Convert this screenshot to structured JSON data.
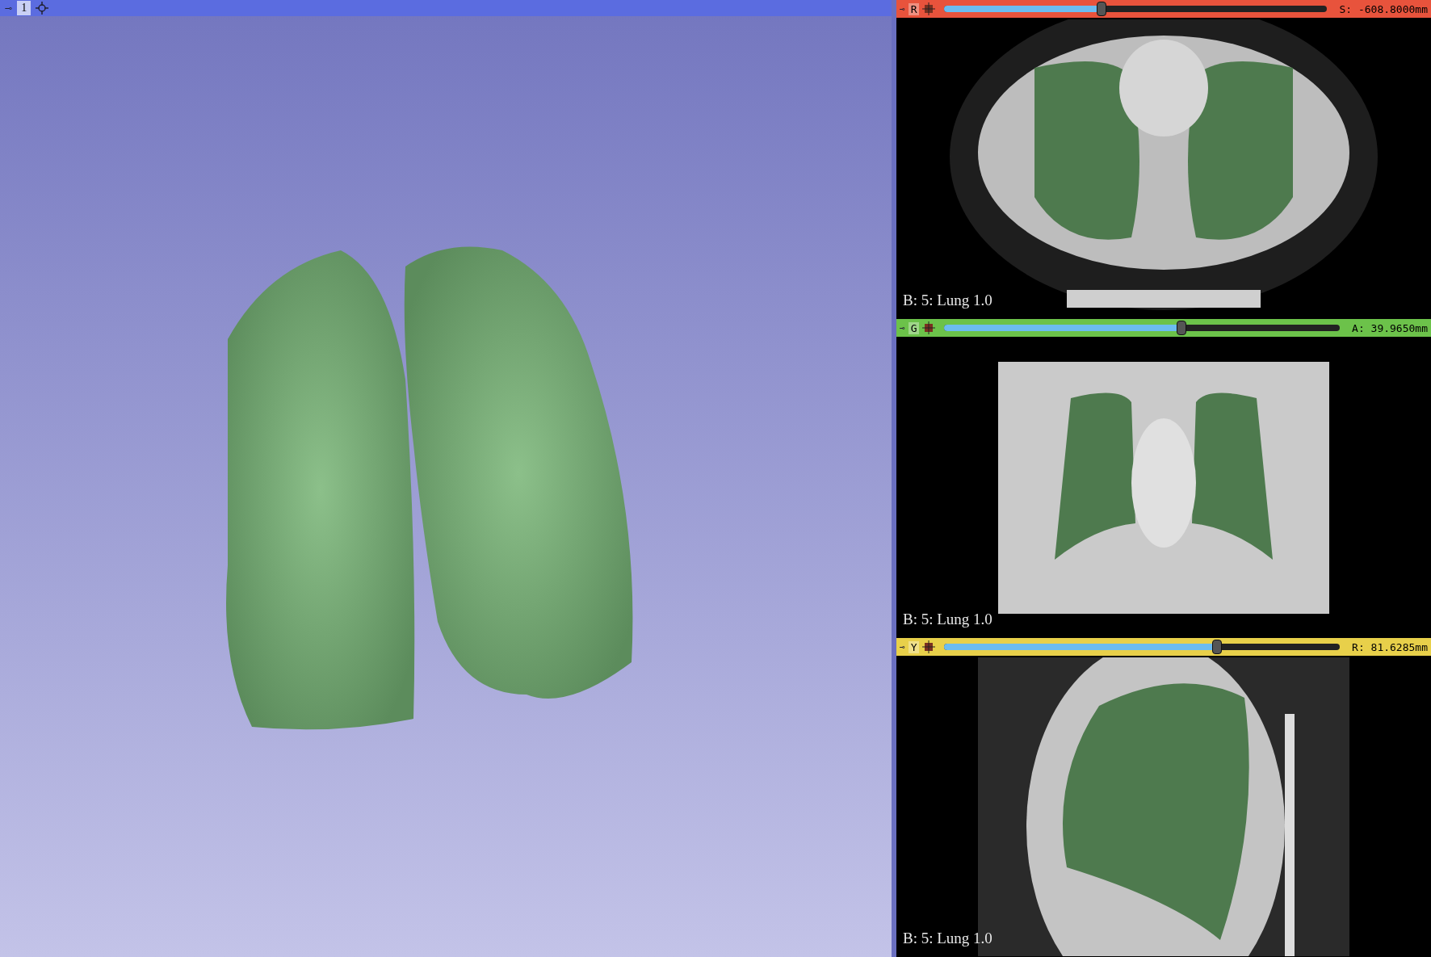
{
  "view_3d": {
    "pin": "⊸",
    "view_number": "1"
  },
  "slice_views": [
    {
      "kind": "axial",
      "color": "#e8533c",
      "letter": "R",
      "level": 0.41,
      "offset": "S: -608.8000mm",
      "label": "B: 5: Lung 1.0"
    },
    {
      "kind": "coronal",
      "color": "#6cc24a",
      "letter": "G",
      "level": 0.6,
      "offset": "A: 39.9650mm",
      "label": "B: 5: Lung 1.0"
    },
    {
      "kind": "sagittal",
      "color": "#e8d04a",
      "letter": "Y",
      "level": 0.69,
      "offset": "R: 81.6285mm",
      "label": "B: 5: Lung 1.0"
    }
  ]
}
